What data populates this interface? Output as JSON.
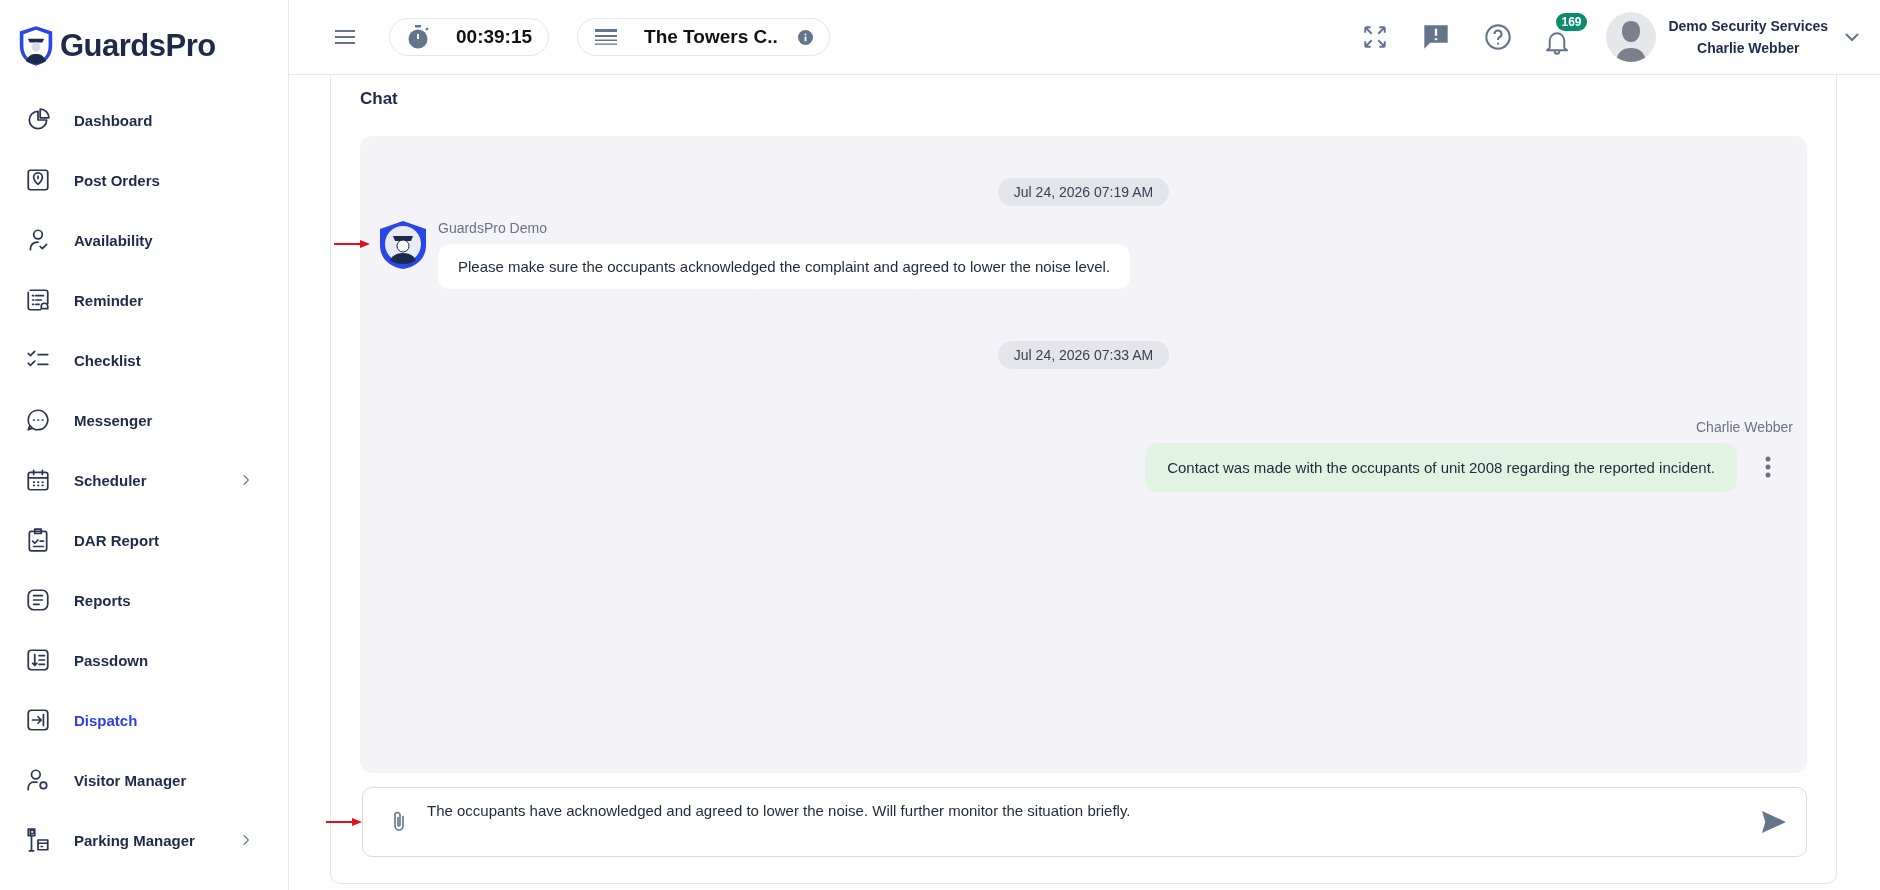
{
  "brand": {
    "name": "GuardsPro"
  },
  "sidebar": {
    "items": [
      {
        "label": "Dashboard",
        "selected": false,
        "expandable": false
      },
      {
        "label": "Post Orders",
        "selected": false,
        "expandable": false
      },
      {
        "label": "Availability",
        "selected": false,
        "expandable": false
      },
      {
        "label": "Reminder",
        "selected": false,
        "expandable": false
      },
      {
        "label": "Checklist",
        "selected": false,
        "expandable": false
      },
      {
        "label": "Messenger",
        "selected": false,
        "expandable": false
      },
      {
        "label": "Scheduler",
        "selected": false,
        "expandable": true
      },
      {
        "label": "DAR Report",
        "selected": false,
        "expandable": false
      },
      {
        "label": "Reports",
        "selected": false,
        "expandable": false
      },
      {
        "label": "Passdown",
        "selected": false,
        "expandable": false
      },
      {
        "label": "Dispatch",
        "selected": true,
        "expandable": false
      },
      {
        "label": "Visitor Manager",
        "selected": false,
        "expandable": false
      },
      {
        "label": "Parking Manager",
        "selected": false,
        "expandable": true
      }
    ]
  },
  "topbar": {
    "timer": "00:39:15",
    "site": "The Towers C..",
    "notifications": "169",
    "company": "Demo Security Services",
    "user": "Charlie Webber"
  },
  "chat": {
    "title": "Chat",
    "messages": [
      {
        "kind": "date",
        "text": "Jul 24, 2026 07:19 AM"
      },
      {
        "kind": "incoming",
        "sender": "GuardsPro Demo",
        "text": "Please make sure the occupants acknowledged the complaint and agreed to lower the noise level."
      },
      {
        "kind": "date",
        "text": "Jul 24, 2026 07:33 AM"
      },
      {
        "kind": "outgoing",
        "sender": "Charlie Webber",
        "text": "Contact was made with the occupants of unit 2008 regarding the reported incident."
      }
    ],
    "composer": {
      "value": "The occupants have acknowledged and agreed to lower the noise. Will further monitor the situation briefly."
    }
  }
}
